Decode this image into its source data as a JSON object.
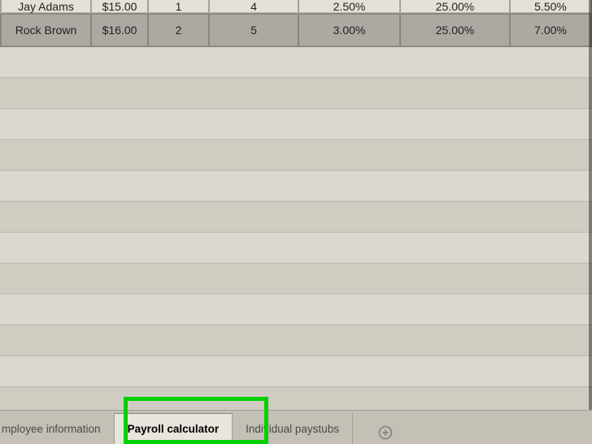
{
  "table": {
    "rows": [
      {
        "name": "Jay Adams",
        "c1": "$15.00",
        "c2": "1",
        "c3": "4",
        "c4": "2.50%",
        "c5": "25.00%",
        "c6": "5.50%"
      },
      {
        "name": "Rock Brown",
        "c1": "$16.00",
        "c2": "2",
        "c3": "5",
        "c4": "3.00%",
        "c5": "25.00%",
        "c6": "7.00%"
      }
    ]
  },
  "tabs": {
    "t0": "mployee information",
    "t1": "Payroll calculator",
    "t2": "Individual paystubs",
    "active_index": 1
  },
  "icons": {
    "add_tab": "plus-circle"
  }
}
